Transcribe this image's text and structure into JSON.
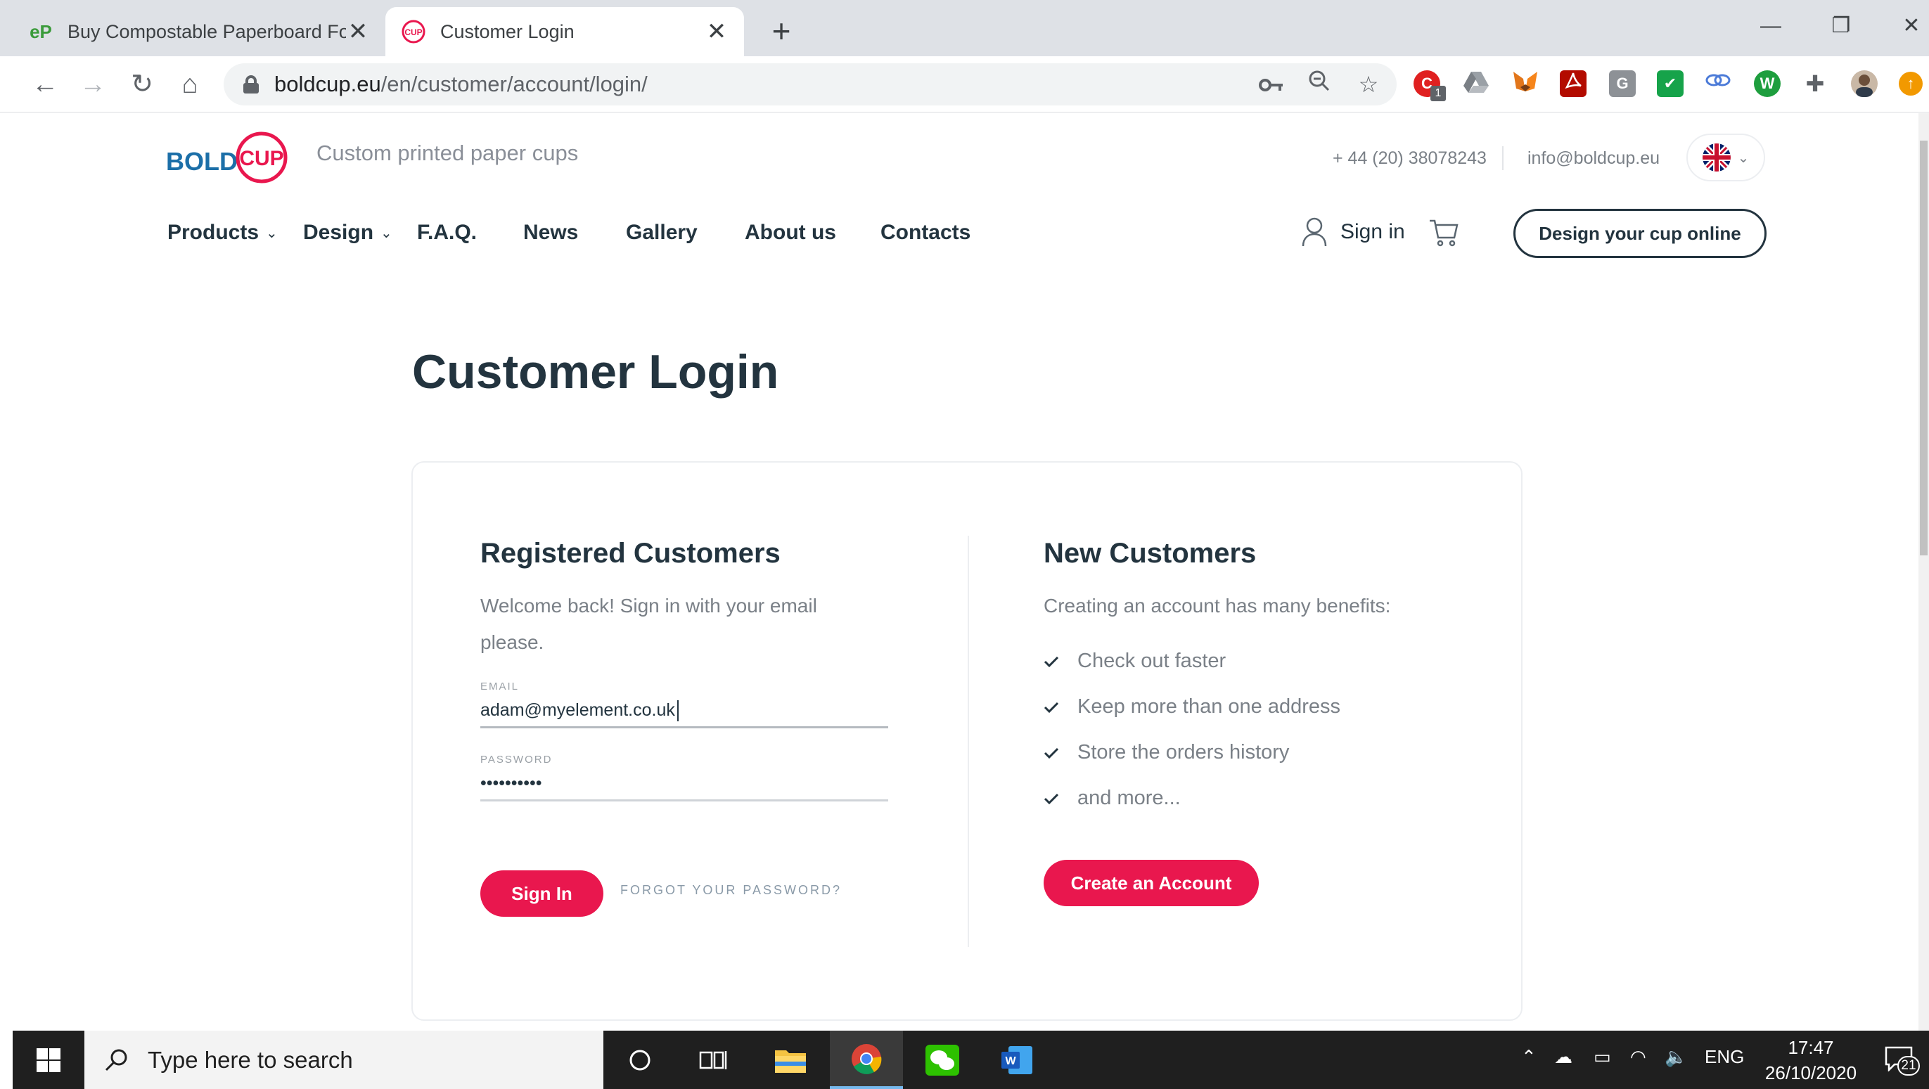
{
  "browser": {
    "tabs": [
      {
        "title": "Buy Compostable Paperboard Fo",
        "favicon": "eP",
        "active": false
      },
      {
        "title": "Customer Login",
        "favicon": "boldcup-logo",
        "active": true
      }
    ],
    "new_tab_symbol": "+",
    "address": {
      "host": "boldcup.eu",
      "path": "/en/customer/account/login/"
    },
    "extension_badge": "1"
  },
  "site": {
    "logo_text_bold": "BOLD",
    "logo_text_cup": "CUP",
    "tagline": "Custom printed paper cups",
    "phone": "+ 44 (20) 38078243",
    "email": "info@boldcup.eu",
    "menu": [
      {
        "label": "Products",
        "has_dropdown": true
      },
      {
        "label": "Design",
        "has_dropdown": true
      },
      {
        "label": "F.A.Q.",
        "has_dropdown": false
      },
      {
        "label": "News",
        "has_dropdown": false
      },
      {
        "label": "Gallery",
        "has_dropdown": false
      },
      {
        "label": "About us",
        "has_dropdown": false
      },
      {
        "label": "Contacts",
        "has_dropdown": false
      }
    ],
    "sign_in_label": "Sign in",
    "design_cta": "Design your cup online"
  },
  "main": {
    "title": "Customer Login",
    "registered": {
      "heading": "Registered Customers",
      "intro_line1": "Welcome back! Sign in with your email",
      "intro_line2": "please.",
      "email_label": "EMAIL",
      "email_value": "adam@myelement.co.uk",
      "password_label": "PASSWORD",
      "password_value": "••••••••••",
      "sign_in_button": "Sign In",
      "forgot_link": "FORGOT YOUR PASSWORD?"
    },
    "new_customers": {
      "heading": "New Customers",
      "intro": "Creating an account has many benefits:",
      "benefits": [
        "Check out faster",
        "Keep more than one address",
        "Store the orders history",
        "and more..."
      ],
      "create_button": "Create an Account"
    }
  },
  "taskbar": {
    "search_placeholder": "Type here to search",
    "language": "ENG",
    "time": "17:47",
    "date": "26/10/2020",
    "notification_count": "21"
  },
  "colors": {
    "brand_pink": "#e9174e",
    "brand_blue": "#1c6fa8",
    "text_dark": "#23343f"
  }
}
